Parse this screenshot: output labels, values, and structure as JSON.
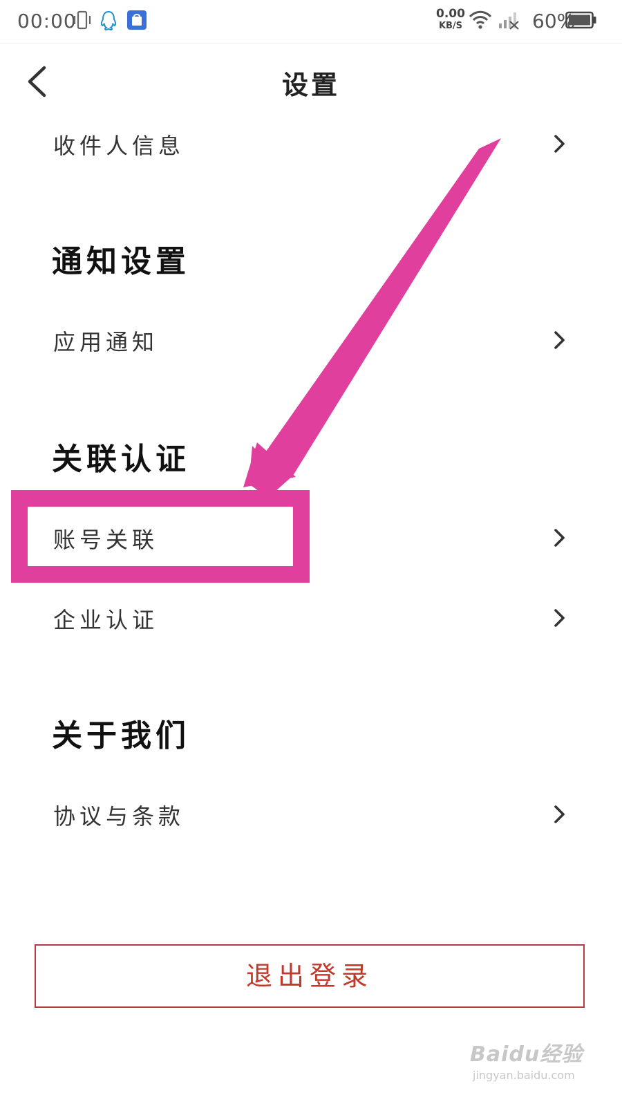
{
  "status_bar": {
    "time": "00:00",
    "net_speed_value": "0.00",
    "net_speed_unit": "KB/S",
    "battery_percent": "60%",
    "icons": [
      "vibrate-icon",
      "qq-icon",
      "shopping-bag-icon",
      "wifi-icon",
      "signal-off-icon",
      "battery-icon"
    ]
  },
  "header": {
    "title": "设置",
    "back_icon": "chevron-left-icon"
  },
  "sections": {
    "receiver_row": {
      "label": "收件人信息"
    },
    "notification": {
      "title": "通知设置",
      "app_notify_row": {
        "label": "应用通知"
      }
    },
    "linked_auth": {
      "title": "关联认证",
      "account_link_row": {
        "label": "账号关联"
      },
      "enterprise_row": {
        "label": "企业认证"
      }
    },
    "about": {
      "title": "关于我们",
      "terms_row": {
        "label": "协议与条款"
      }
    }
  },
  "logout_button": {
    "label": "退出登录"
  },
  "watermark": {
    "brand": "Baidu经验",
    "url": "jingyan.baidu.com"
  },
  "colors": {
    "annotation": "#e03f9e",
    "logout_text": "#c0392b",
    "logout_border": "#b43c3c"
  }
}
